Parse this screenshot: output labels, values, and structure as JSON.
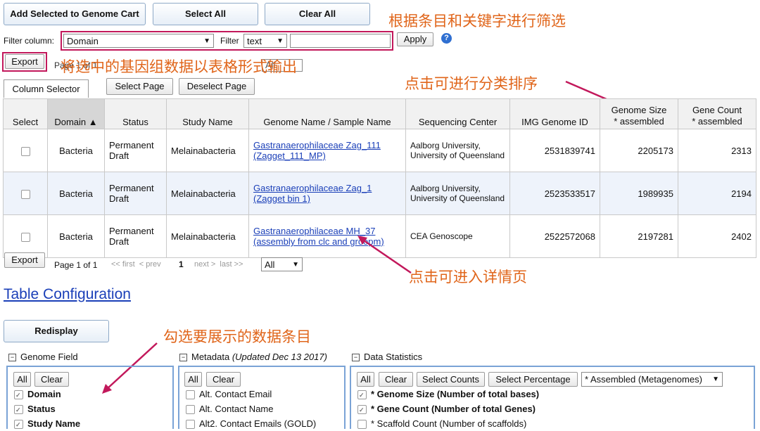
{
  "toolbar": {
    "add_selected": "Add Selected to Genome Cart",
    "select_all": "Select All",
    "clear_all": "Clear All"
  },
  "filter": {
    "column_label": "Filter column:",
    "column_value": "Domain",
    "filter_label": "Filter",
    "type_value": "text",
    "text_value": "",
    "apply": "Apply",
    "help_icon": "help-icon"
  },
  "export_top": {
    "label": "Export",
    "page_text": "Page 1 of 1",
    "page_size": "All"
  },
  "annotations": {
    "filter_note": "根据条目和关键字进行筛选",
    "export_note": "将选中的基因组数据以表格形式输出",
    "sort_note": "点击可进行分类排序",
    "detail_note": "点击可进入详情页",
    "select_note": "勾选要展示的数据条目"
  },
  "selector_bar": {
    "column_selector": "Column Selector",
    "select_page": "Select Page",
    "deselect_page": "Deselect Page"
  },
  "table": {
    "headers": [
      "Select",
      "Domain ▲",
      "Status",
      "Study Name",
      "Genome Name / Sample Name",
      "Sequencing Center",
      "IMG Genome ID",
      "Genome Size\n* assembled",
      "Gene Count\n* assembled"
    ],
    "rows": [
      {
        "domain": "Bacteria",
        "status": "Permanent Draft",
        "study": "Melainabacteria",
        "genome": "Gastranaerophilaceae Zag_111 (Zagget_111_MP)",
        "center": "Aalborg University, University of Queensland",
        "id": "2531839741",
        "size": "2205173",
        "genes": "2313"
      },
      {
        "domain": "Bacteria",
        "status": "Permanent Draft",
        "study": "Melainabacteria",
        "genome": "Gastranaerophilaceae Zag_1 (Zagget bin 1)",
        "center": "Aalborg University, University of Queensland",
        "id": "2523533517",
        "size": "1989935",
        "genes": "2194"
      },
      {
        "domain": "Bacteria",
        "status": "Permanent Draft",
        "study": "Melainabacteria",
        "genome": "Gastranaerophilaceae MH_37 (assembly from clc and groopm)",
        "center": "CEA Genoscope",
        "id": "2522572068",
        "size": "2197281",
        "genes": "2402"
      }
    ]
  },
  "pager": {
    "export": "Export",
    "page_text": "Page 1 of 1",
    "first_prev": "<< first  < prev",
    "current": "1",
    "next_last": "next >  last >>",
    "page_size": "All"
  },
  "config": {
    "title": "Table Configuration",
    "redisplay": "Redisplay",
    "genome_field": {
      "title": "Genome Field",
      "all": "All",
      "clear": "Clear",
      "items": [
        {
          "label": "Domain",
          "checked": true
        },
        {
          "label": "Status",
          "checked": true
        },
        {
          "label": "Study Name",
          "checked": true
        }
      ]
    },
    "metadata": {
      "title": "Metadata",
      "updated": "(Updated Dec 13 2017)",
      "all": "All",
      "clear": "Clear",
      "items": [
        {
          "label": "Alt. Contact Email",
          "checked": false
        },
        {
          "label": "Alt. Contact Name",
          "checked": false
        },
        {
          "label": "Alt2. Contact Emails (GOLD)",
          "checked": false
        }
      ]
    },
    "data_statistics": {
      "title": "Data Statistics",
      "all": "All",
      "clear": "Clear",
      "select_counts": "Select Counts",
      "select_percentage": "Select Percentage",
      "mode": "* Assembled (Metagenomes)",
      "items": [
        {
          "label": "* Genome Size (Number of total bases)",
          "checked": true
        },
        {
          "label": "* Gene Count (Number of total Genes)",
          "checked": true
        },
        {
          "label": "* Scaffold Count (Number of scaffolds)",
          "checked": false
        }
      ]
    }
  },
  "colors": {
    "annotation": "#e0651a",
    "highlight_box": "#c2185b",
    "link": "#1a3fb8",
    "panel_border": "#7aa3d6"
  }
}
